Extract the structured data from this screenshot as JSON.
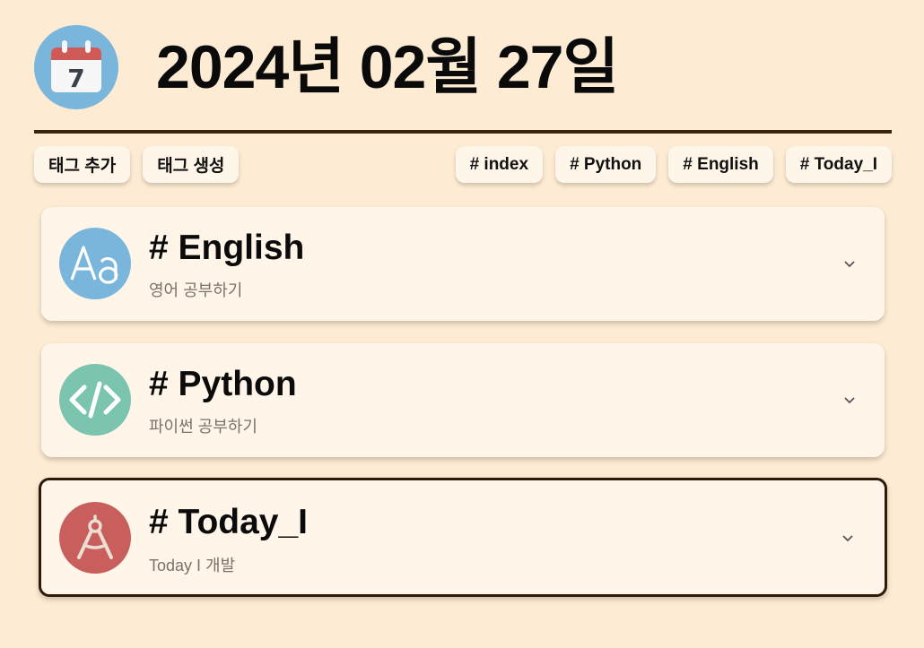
{
  "header": {
    "title": "2024년 02월 27일",
    "calendar_day": "7",
    "calendar_icon": "calendar-icon"
  },
  "toolbar": {
    "add_tag_label": "태그 추가",
    "create_tag_label": "태그 생성",
    "filter_tags": [
      "# index",
      "# Python",
      "# English",
      "# Today_I"
    ]
  },
  "cards": [
    {
      "title": "# English",
      "subtitle": "영어 공부하기",
      "icon": "alphabet-aa-icon",
      "icon_color": "#7ab5db",
      "selected": false
    },
    {
      "title": "# Python",
      "subtitle": "파이썬 공부하기",
      "icon": "code-brackets-icon",
      "icon_color": "#7bc4b0",
      "selected": false
    },
    {
      "title": "# Today_I",
      "subtitle": "Today I 개발",
      "icon": "compass-drafting-icon",
      "icon_color": "#c95f5c",
      "selected": true
    }
  ],
  "colors": {
    "background": "#fdebd3",
    "card_background": "#fff5e9",
    "divider": "#3a2410",
    "selected_border": "#2f1a08"
  }
}
